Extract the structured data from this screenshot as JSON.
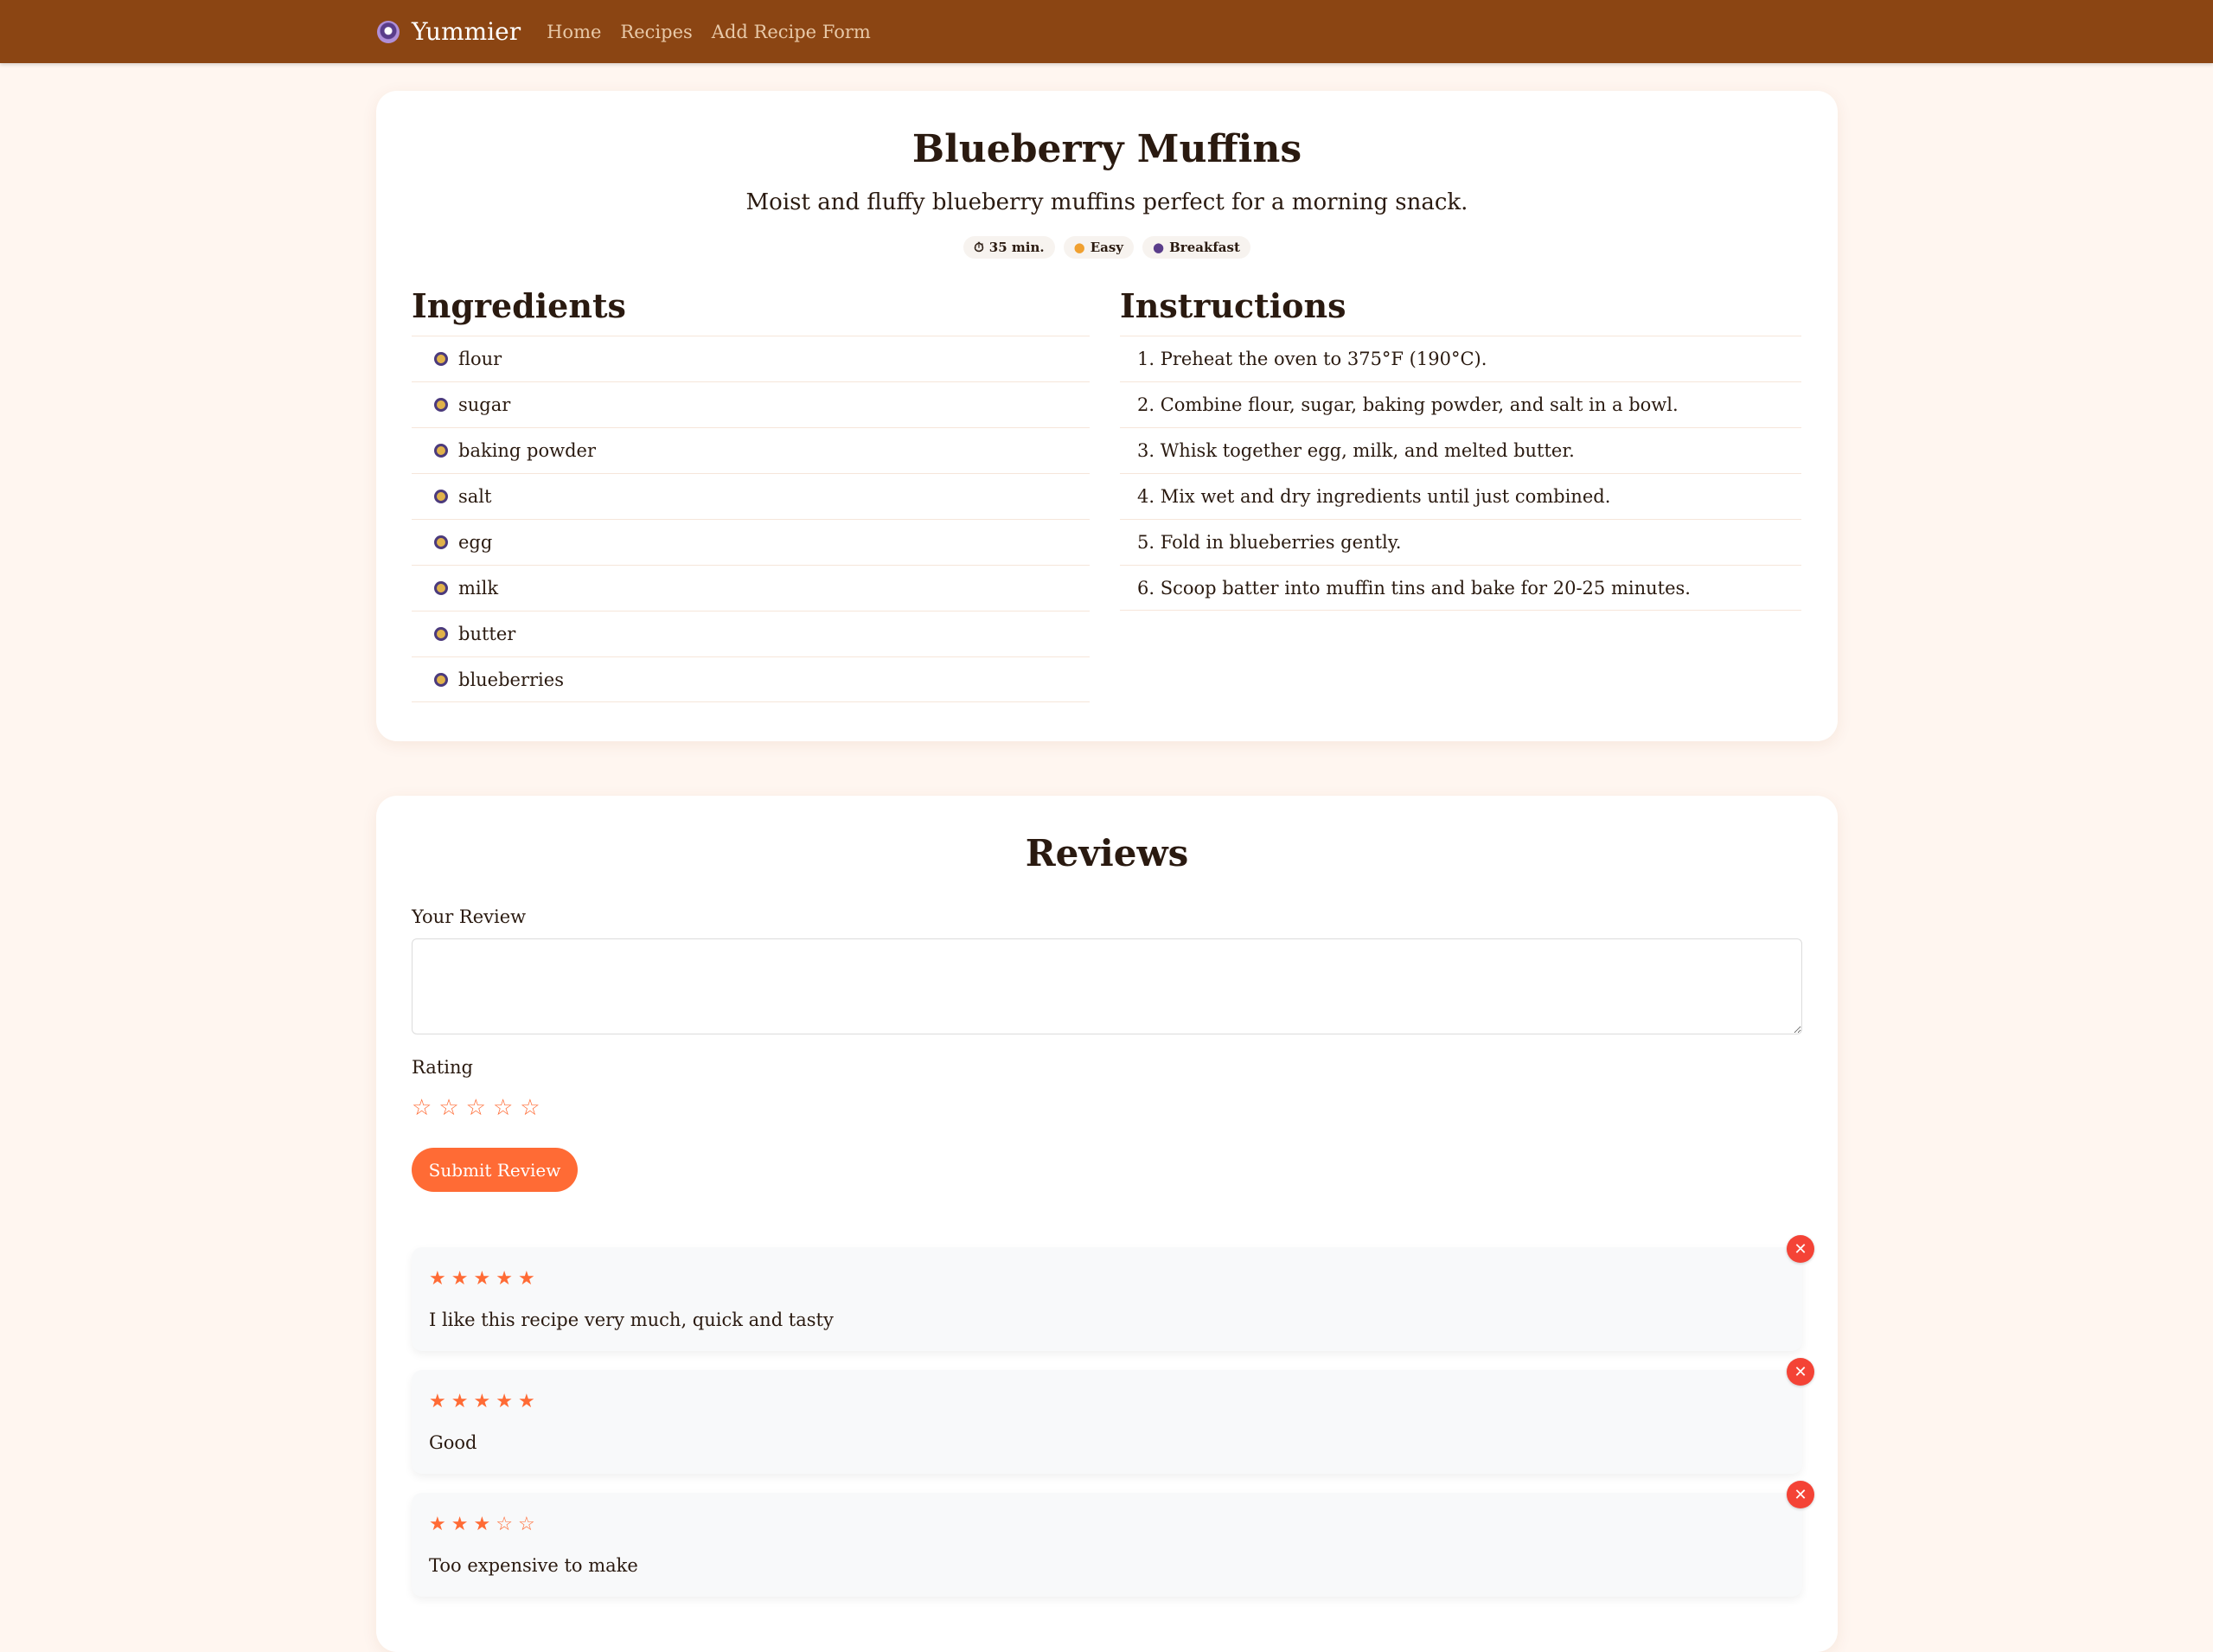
{
  "nav": {
    "brand": "Yummier",
    "links": [
      "Home",
      "Recipes",
      "Add Recipe Form"
    ]
  },
  "recipe": {
    "title": "Blueberry Muffins",
    "description": "Moist and fluffy blueberry muffins perfect for a morning snack.",
    "badges": {
      "time": "35 min.",
      "difficulty": "Easy",
      "category": "Breakfast"
    },
    "ingredients_heading": "Ingredients",
    "instructions_heading": "Instructions",
    "ingredients": [
      "flour",
      "sugar",
      "baking powder",
      "salt",
      "egg",
      "milk",
      "butter",
      "blueberries"
    ],
    "instructions": [
      "1. Preheat the oven to 375°F (190°C).",
      "2. Combine flour, sugar, baking powder, and salt in a bowl.",
      "3. Whisk together egg, milk, and melted butter.",
      "4. Mix wet and dry ingredients until just combined.",
      "5. Fold in blueberries gently.",
      "6. Scoop batter into muffin tins and bake for 20-25 minutes."
    ]
  },
  "reviews": {
    "title": "Reviews",
    "review_label": "Your Review",
    "review_placeholder": "",
    "rating_label": "Rating",
    "rating_value": 0,
    "submit_label": "Submit Review",
    "items": [
      {
        "rating": 5,
        "text": "I like this recipe very much, quick and tasty"
      },
      {
        "rating": 5,
        "text": "Good"
      },
      {
        "rating": 3,
        "text": "Too expensive to make"
      }
    ]
  },
  "colors": {
    "nav_bg": "#8b4513",
    "accent": "#ff6b35",
    "delete": "#f44336",
    "page_bg": "#fff6f0"
  }
}
